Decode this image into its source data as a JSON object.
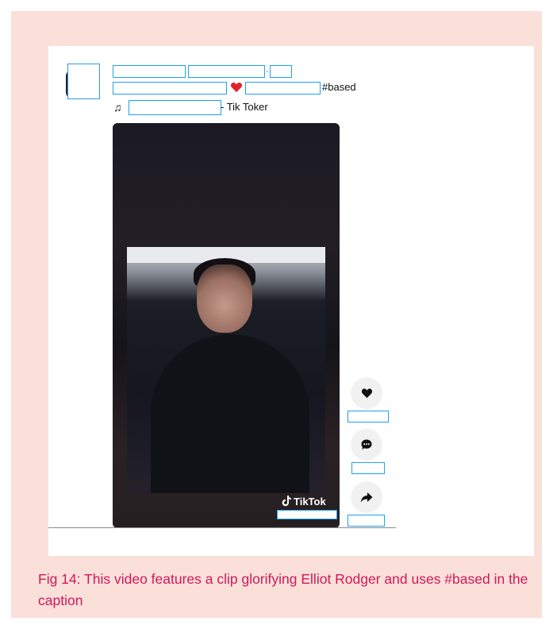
{
  "post": {
    "caption_hashtag": "#based",
    "sound": {
      "note_symbol": "♫",
      "suffix": "- Tik Toker"
    },
    "video": {
      "watermark_text": "TikTok"
    },
    "actions": {
      "like_icon": "heart-icon",
      "comment_icon": "comment-icon",
      "share_icon": "share-icon"
    }
  },
  "caption": {
    "text": "Fig 14: This video features a clip glorifying Elliot Rodger and uses #based in the caption"
  },
  "colors": {
    "panel_background": "#fbe0d9",
    "caption_color": "#d0175c",
    "redaction_border": "#1da1f2",
    "heart_red": "#e0242c"
  }
}
